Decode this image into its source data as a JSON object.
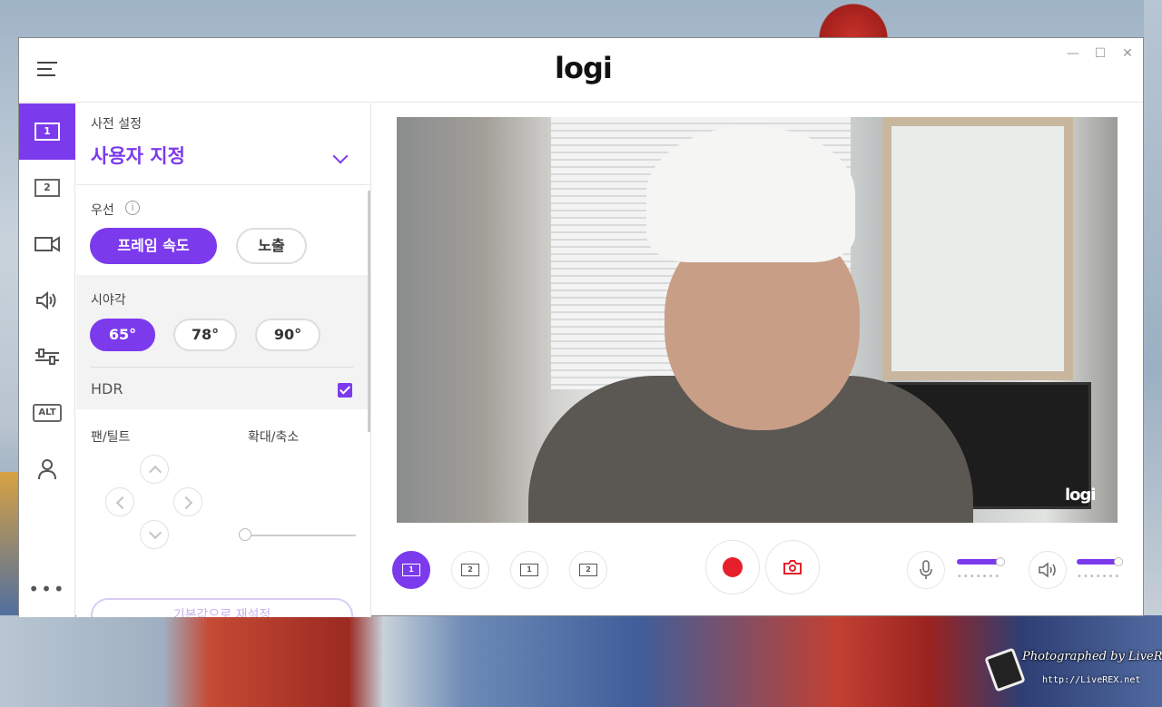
{
  "app": {
    "logo_text": "logi",
    "window_controls": {
      "minimize": "—",
      "maximize": "☐",
      "close": "✕"
    }
  },
  "rail": {
    "items": [
      {
        "label": "1",
        "icon": "preset-1-icon",
        "active": true
      },
      {
        "label": "2",
        "icon": "preset-2-icon",
        "active": false
      },
      {
        "icon": "video-camera-icon"
      },
      {
        "icon": "speaker-icon"
      },
      {
        "icon": "sliders-icon"
      },
      {
        "label": "ALT",
        "icon": "alt-icon"
      },
      {
        "icon": "user-icon"
      },
      {
        "label": "•••",
        "icon": "more-icon"
      }
    ]
  },
  "panel": {
    "preset_label": "사전 설정",
    "preset_value": "사용자 지정",
    "priority_label": "우선",
    "priority_options": [
      "프레임 속도",
      "노출"
    ],
    "priority_selected": "프레임 속도",
    "fov_label": "시야각",
    "fov_options": [
      "65°",
      "78°",
      "90°"
    ],
    "fov_selected": "65°",
    "hdr_label": "HDR",
    "hdr_checked": true,
    "pan_tilt_label": "팬/틸트",
    "zoom_label": "확대/축소",
    "zoom_level": 0,
    "reset_label": "기본값으로 재설정"
  },
  "preview": {
    "overlay_logo": "logi"
  },
  "controls": {
    "preset_buttons": [
      "1",
      "2",
      "1",
      "2"
    ],
    "mic_level": 0.85,
    "speaker_level": 0.85
  },
  "watermark": {
    "text": "Photographed by LiveREX",
    "url": "http://LiveREX.net"
  },
  "colors": {
    "accent": "#7c3aed",
    "record": "#e5202a"
  }
}
